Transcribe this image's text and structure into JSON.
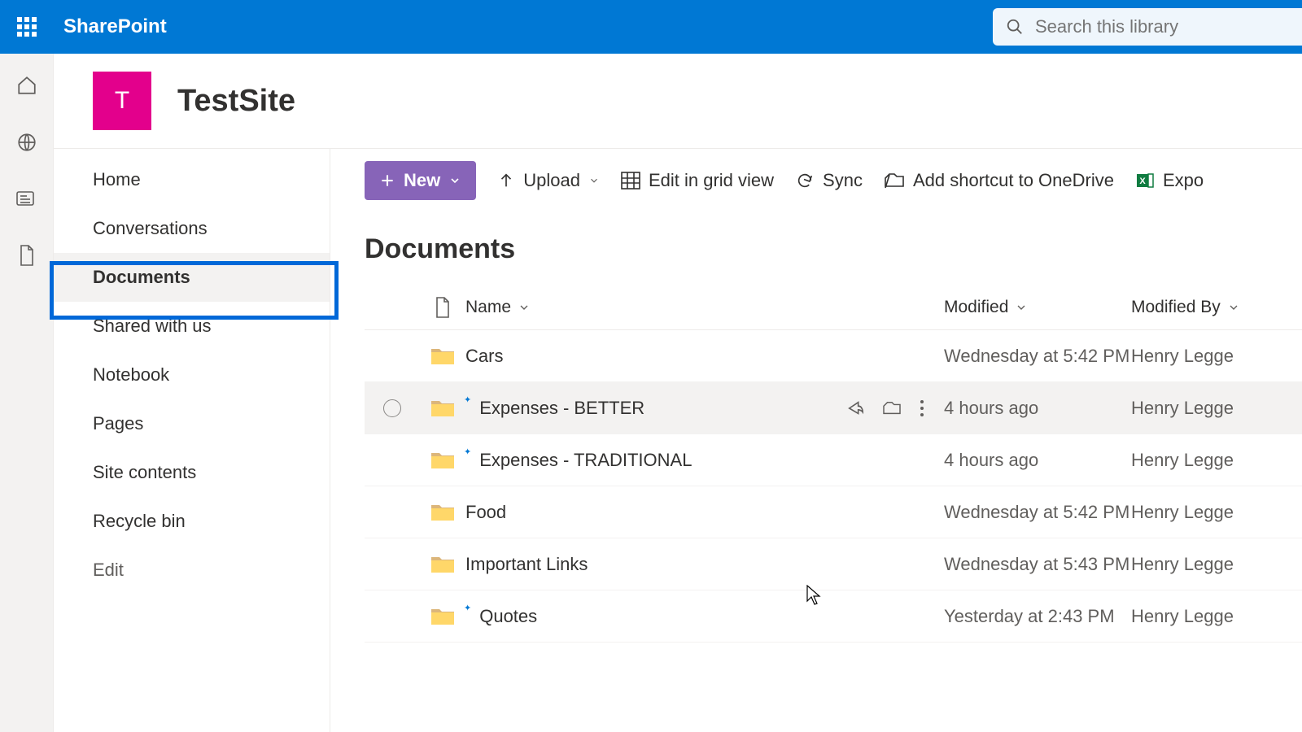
{
  "suite": {
    "title": "SharePoint"
  },
  "search": {
    "placeholder": "Search this library"
  },
  "site": {
    "initial": "T",
    "title": "TestSite"
  },
  "nav": {
    "items": [
      {
        "label": "Home"
      },
      {
        "label": "Conversations"
      },
      {
        "label": "Documents"
      },
      {
        "label": "Shared with us"
      },
      {
        "label": "Notebook"
      },
      {
        "label": "Pages"
      },
      {
        "label": "Site contents"
      },
      {
        "label": "Recycle bin"
      }
    ],
    "edit": "Edit"
  },
  "commands": {
    "new": "New",
    "upload": "Upload",
    "gridview": "Edit in grid view",
    "sync": "Sync",
    "shortcut": "Add shortcut to OneDrive",
    "export": "Expo"
  },
  "page": {
    "heading": "Documents"
  },
  "columns": {
    "name": "Name",
    "modified": "Modified",
    "modifiedBy": "Modified By"
  },
  "rows": [
    {
      "name": "Cars",
      "modified": "Wednesday at 5:42 PM",
      "by": "Henry Legge",
      "new": false
    },
    {
      "name": "Expenses - BETTER",
      "modified": "4 hours ago",
      "by": "Henry Legge",
      "new": true
    },
    {
      "name": "Expenses - TRADITIONAL",
      "modified": "4 hours ago",
      "by": "Henry Legge",
      "new": true
    },
    {
      "name": "Food",
      "modified": "Wednesday at 5:42 PM",
      "by": "Henry Legge",
      "new": false
    },
    {
      "name": "Important Links",
      "modified": "Wednesday at 5:43 PM",
      "by": "Henry Legge",
      "new": false
    },
    {
      "name": "Quotes",
      "modified": "Yesterday at 2:43 PM",
      "by": "Henry Legge",
      "new": true
    }
  ]
}
